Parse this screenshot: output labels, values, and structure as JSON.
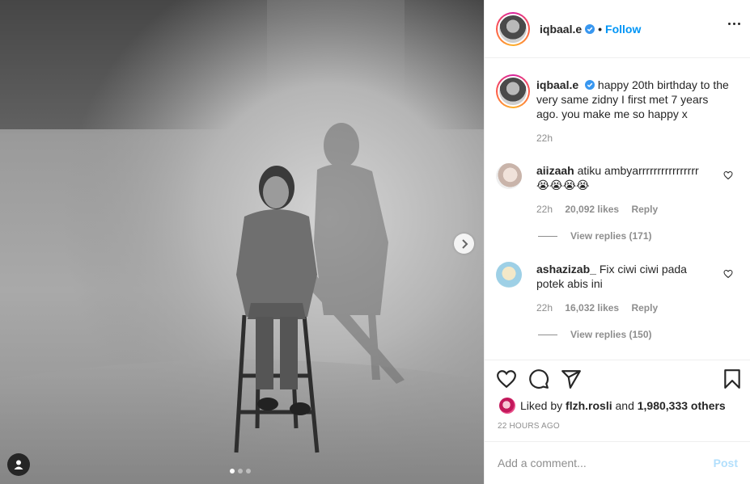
{
  "post": {
    "username": "iqbaal.e",
    "separator": "•",
    "follow_label": "Follow",
    "caption": "happy 20th birthday to the very same zidny I first met 7 years ago. you make me so happy x",
    "caption_time": "22h"
  },
  "comments": [
    {
      "username": "aiizaah",
      "text": "atiku ambyarrrrrrrrrrrrrrrr 😭😭😭😭",
      "time": "22h",
      "likes": "20,092 likes",
      "reply_label": "Reply",
      "view_replies": "View replies (171)"
    },
    {
      "username": "ashazizab_",
      "text": "Fix ciwi ciwi pada potek abis ini",
      "time": "22h",
      "likes": "16,032 likes",
      "reply_label": "Reply",
      "view_replies": "View replies (150)"
    }
  ],
  "likes": {
    "prefix": "Liked by",
    "user": "flzh.rosli",
    "joiner": "and",
    "others": "1,980,333 others"
  },
  "timestamp": "22 HOURS AGO",
  "add_comment": {
    "placeholder": "Add a comment...",
    "post_label": "Post"
  },
  "carousel": {
    "total": 3,
    "active": 1
  },
  "colors": {
    "accent": "#0095f6",
    "verified": "#3897f0",
    "muted": "#8e8e8e",
    "post_disabled": "#b2dffc"
  },
  "icons": [
    "more-icon",
    "verified-icon",
    "heart-icon",
    "comment-icon",
    "share-icon",
    "bookmark-icon",
    "chevron-right-icon",
    "user-tag-icon"
  ]
}
